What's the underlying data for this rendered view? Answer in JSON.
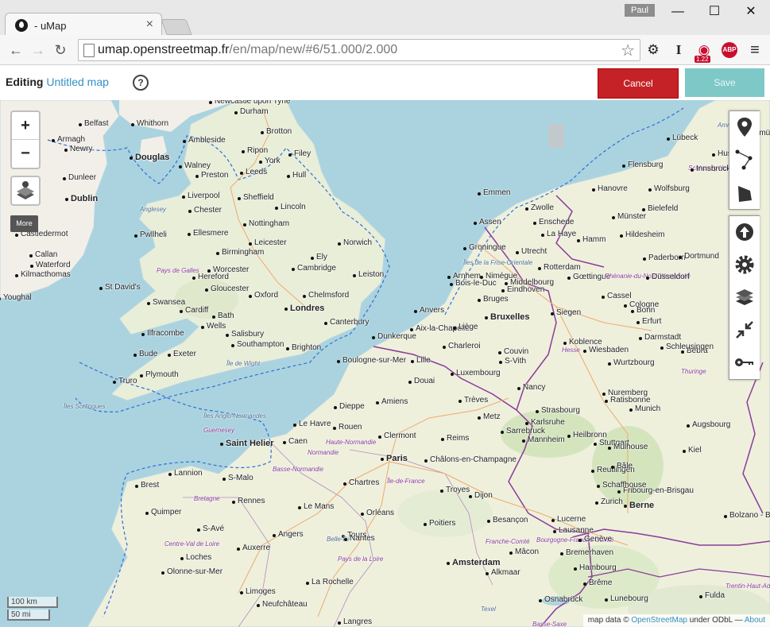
{
  "browser": {
    "tab_title": "- uMap",
    "tab_close": "×",
    "user": "Paul",
    "url_host": "umap.openstreetmap.fr",
    "url_path": "/en/map/new/#6/51.000/2.000",
    "minimize": "—",
    "maximize": "☐",
    "close": "✕",
    "ext_lock_version": "1.22",
    "ext_abp": "ABP"
  },
  "header": {
    "editing_label": "Editing",
    "map_name": "Untitled map",
    "help": "?",
    "cancel_label": "Cancel",
    "save_label": "Save"
  },
  "map_controls": {
    "zoom_in": "+",
    "zoom_out": "−",
    "more": "More"
  },
  "scale": {
    "km": "100 km",
    "mi": "50 mi"
  },
  "attribution": {
    "prefix": "map data ©",
    "osm": "OpenStreetMap",
    "license": "under ODbL —",
    "about": "About"
  },
  "places": [
    {
      "name": "Belfast",
      "type": "city"
    },
    {
      "name": "Armagh",
      "type": "city"
    },
    {
      "name": "Newry",
      "type": "city"
    },
    {
      "name": "Whithorn",
      "type": "city"
    },
    {
      "name": "Douglas",
      "type": "capital"
    },
    {
      "name": "Dunleer",
      "type": "city"
    },
    {
      "name": "Dublin",
      "type": "capital"
    },
    {
      "name": "Castledermot",
      "type": "city"
    },
    {
      "name": "Callan",
      "type": "city"
    },
    {
      "name": "Waterford",
      "type": "city"
    },
    {
      "name": "Kilmacthomas",
      "type": "city"
    },
    {
      "name": "Youghal",
      "type": "city"
    },
    {
      "name": "Newcastle upon Tyne",
      "type": "city"
    },
    {
      "name": "Durham",
      "type": "city"
    },
    {
      "name": "Brotton",
      "type": "city"
    },
    {
      "name": "Ambleside",
      "type": "city"
    },
    {
      "name": "Ripon",
      "type": "city"
    },
    {
      "name": "Filey",
      "type": "city"
    },
    {
      "name": "Walney",
      "type": "city"
    },
    {
      "name": "York",
      "type": "city"
    },
    {
      "name": "Preston",
      "type": "city"
    },
    {
      "name": "Leeds",
      "type": "city"
    },
    {
      "name": "Hull",
      "type": "city"
    },
    {
      "name": "Liverpool",
      "type": "city"
    },
    {
      "name": "Sheffield",
      "type": "city"
    },
    {
      "name": "Chester",
      "type": "city"
    },
    {
      "name": "Lincoln",
      "type": "city"
    },
    {
      "name": "Nottingham",
      "type": "city"
    },
    {
      "name": "Pwllheli",
      "type": "city"
    },
    {
      "name": "Ellesmere",
      "type": "city"
    },
    {
      "name": "Leicester",
      "type": "city"
    },
    {
      "name": "Norwich",
      "type": "city"
    },
    {
      "name": "Birmingham",
      "type": "city"
    },
    {
      "name": "Ely",
      "type": "city"
    },
    {
      "name": "Cambridge",
      "type": "city"
    },
    {
      "name": "Leiston",
      "type": "city"
    },
    {
      "name": "Worcester",
      "type": "city"
    },
    {
      "name": "Hereford",
      "type": "city"
    },
    {
      "name": "Gloucester",
      "type": "city"
    },
    {
      "name": "St David's",
      "type": "city"
    },
    {
      "name": "Oxford",
      "type": "city"
    },
    {
      "name": "Chelmsford",
      "type": "city"
    },
    {
      "name": "Londres",
      "type": "capital"
    },
    {
      "name": "Swansea",
      "type": "city"
    },
    {
      "name": "Cardiff",
      "type": "city"
    },
    {
      "name": "Bath",
      "type": "city"
    },
    {
      "name": "Wells",
      "type": "city"
    },
    {
      "name": "Canterbury",
      "type": "city"
    },
    {
      "name": "Ilfracombe",
      "type": "city"
    },
    {
      "name": "Salisbury",
      "type": "city"
    },
    {
      "name": "Southampton",
      "type": "city"
    },
    {
      "name": "Brighton",
      "type": "city"
    },
    {
      "name": "Bude",
      "type": "city"
    },
    {
      "name": "Exeter",
      "type": "city"
    },
    {
      "name": "Plymouth",
      "type": "city"
    },
    {
      "name": "Truro",
      "type": "city"
    },
    {
      "name": "Îles Sorlingues",
      "type": "sea"
    },
    {
      "name": "Anglesey",
      "type": "sea"
    },
    {
      "name": "Pays de Galles",
      "type": "region"
    },
    {
      "name": "Île de Wight",
      "type": "sea"
    },
    {
      "name": "Îles Anglo-Normandes",
      "type": "sea"
    },
    {
      "name": "Guernesey",
      "type": "region"
    },
    {
      "name": "Saint Helier",
      "type": "capital"
    },
    {
      "name": "Dunkerque",
      "type": "city"
    },
    {
      "name": "Boulogne-sur-Mer",
      "type": "city"
    },
    {
      "name": "Lille",
      "type": "city"
    },
    {
      "name": "Douai",
      "type": "city"
    },
    {
      "name": "Dieppe",
      "type": "city"
    },
    {
      "name": "Amiens",
      "type": "city"
    },
    {
      "name": "Le Havre",
      "type": "city"
    },
    {
      "name": "Rouen",
      "type": "city"
    },
    {
      "name": "Caen",
      "type": "city"
    },
    {
      "name": "Haute-Normandie",
      "type": "region"
    },
    {
      "name": "Normandie",
      "type": "region"
    },
    {
      "name": "Basse-Normandie",
      "type": "region"
    },
    {
      "name": "Clermont",
      "type": "city"
    },
    {
      "name": "Reims",
      "type": "city"
    },
    {
      "name": "Paris",
      "type": "capital"
    },
    {
      "name": "Châlons-en-Champagne",
      "type": "city"
    },
    {
      "name": "Île-de-France",
      "type": "region"
    },
    {
      "name": "Lannion",
      "type": "city"
    },
    {
      "name": "S-Malo",
      "type": "city"
    },
    {
      "name": "Brest",
      "type": "city"
    },
    {
      "name": "Bretagne",
      "type": "region"
    },
    {
      "name": "Rennes",
      "type": "city"
    },
    {
      "name": "Chartres",
      "type": "city"
    },
    {
      "name": "Troyes",
      "type": "city"
    },
    {
      "name": "Quimper",
      "type": "city"
    },
    {
      "name": "Le Mans",
      "type": "city"
    },
    {
      "name": "Orléans",
      "type": "city"
    },
    {
      "name": "S-Avé",
      "type": "city"
    },
    {
      "name": "Angers",
      "type": "city"
    },
    {
      "name": "Tours",
      "type": "city"
    },
    {
      "name": "Centre-Val de Loire",
      "type": "region"
    },
    {
      "name": "Belle-Île",
      "type": "sea"
    },
    {
      "name": "Nantes",
      "type": "city"
    },
    {
      "name": "Loches",
      "type": "city"
    },
    {
      "name": "Auxerre",
      "type": "city"
    },
    {
      "name": "Pays de la Loire",
      "type": "region"
    },
    {
      "name": "Poitiers",
      "type": "city"
    },
    {
      "name": "Olonne-sur-Mer",
      "type": "city"
    },
    {
      "name": "La Rochelle",
      "type": "city"
    },
    {
      "name": "Limoges",
      "type": "city"
    },
    {
      "name": "Neufchâteau",
      "type": "city"
    },
    {
      "name": "Langres",
      "type": "city"
    },
    {
      "name": "Dijon",
      "type": "city"
    },
    {
      "name": "Besançon",
      "type": "city"
    },
    {
      "name": "Franche-Comté",
      "type": "region"
    },
    {
      "name": "Bourgogne-Franche-Comté",
      "type": "region"
    },
    {
      "name": "Mâcon",
      "type": "city"
    },
    {
      "name": "Amsterdam",
      "type": "capital"
    },
    {
      "name": "Alkmaar",
      "type": "city"
    },
    {
      "name": "Texel",
      "type": "sea"
    },
    {
      "name": "Îles de la Frise-Orientale",
      "type": "sea"
    },
    {
      "name": "Groningue",
      "type": "city"
    },
    {
      "name": "Assen",
      "type": "city"
    },
    {
      "name": "Emmen",
      "type": "city"
    },
    {
      "name": "Zwolle",
      "type": "city"
    },
    {
      "name": "Enschede",
      "type": "city"
    },
    {
      "name": "La Haye",
      "type": "city"
    },
    {
      "name": "Utrecht",
      "type": "city"
    },
    {
      "name": "Rotterdam",
      "type": "city"
    },
    {
      "name": "Arnhem",
      "type": "city"
    },
    {
      "name": "Nimègue",
      "type": "city"
    },
    {
      "name": "Bois-le-Duc",
      "type": "city"
    },
    {
      "name": "Middelbourg",
      "type": "city"
    },
    {
      "name": "Eindhoven",
      "type": "city"
    },
    {
      "name": "Bruges",
      "type": "city"
    },
    {
      "name": "Anvers",
      "type": "city"
    },
    {
      "name": "Bruxelles",
      "type": "capital"
    },
    {
      "name": "Aix-la-Chapelle",
      "type": "city"
    },
    {
      "name": "Liège",
      "type": "city"
    },
    {
      "name": "Charleroi",
      "type": "city"
    },
    {
      "name": "Couvin",
      "type": "city"
    },
    {
      "name": "S-Vith",
      "type": "city"
    },
    {
      "name": "Luxembourg",
      "type": "city"
    },
    {
      "name": "Trèves",
      "type": "city"
    },
    {
      "name": "Metz",
      "type": "city"
    },
    {
      "name": "Nancy",
      "type": "city"
    },
    {
      "name": "Strasbourg",
      "type": "city"
    },
    {
      "name": "Sarrebruck",
      "type": "city"
    },
    {
      "name": "Karlsruhe",
      "type": "city"
    },
    {
      "name": "Mannheim",
      "type": "city"
    },
    {
      "name": "Heilbronn",
      "type": "city"
    },
    {
      "name": "Stuttgart",
      "type": "city"
    },
    {
      "name": "Reutlingen",
      "type": "city"
    },
    {
      "name": "Fribourg-en-Brisgau",
      "type": "city"
    },
    {
      "name": "Mulhouse",
      "type": "city"
    },
    {
      "name": "Bâle",
      "type": "city"
    },
    {
      "name": "Schaffhouse",
      "type": "city"
    },
    {
      "name": "Zurich",
      "type": "city"
    },
    {
      "name": "Berne",
      "type": "capital"
    },
    {
      "name": "Lucerne",
      "type": "city"
    },
    {
      "name": "Lausanne",
      "type": "city"
    },
    {
      "name": "Genève",
      "type": "city"
    },
    {
      "name": "Bremerhaven",
      "type": "city"
    },
    {
      "name": "Hambourg",
      "type": "city"
    },
    {
      "name": "Brême",
      "type": "city"
    },
    {
      "name": "Lunebourg",
      "type": "city"
    },
    {
      "name": "Basse-Saxe",
      "type": "region"
    },
    {
      "name": "Osnabrück",
      "type": "city"
    },
    {
      "name": "Hanovre",
      "type": "city"
    },
    {
      "name": "Wolfsburg",
      "type": "city"
    },
    {
      "name": "Münster",
      "type": "city"
    },
    {
      "name": "Bielefeld",
      "type": "city"
    },
    {
      "name": "Hildesheim",
      "type": "city"
    },
    {
      "name": "Hamm",
      "type": "city"
    },
    {
      "name": "Paderborn",
      "type": "city"
    },
    {
      "name": "Dortmund",
      "type": "city"
    },
    {
      "name": "Gœttingue",
      "type": "city"
    },
    {
      "name": "Rhénanie-du-Nord-Westphalie",
      "type": "region"
    },
    {
      "name": "Düsseldorf",
      "type": "city"
    },
    {
      "name": "Cassel",
      "type": "city"
    },
    {
      "name": "Cologne",
      "type": "city"
    },
    {
      "name": "Bonn",
      "type": "city"
    },
    {
      "name": "Siegen",
      "type": "city"
    },
    {
      "name": "Erfurt",
      "type": "city"
    },
    {
      "name": "Koblence",
      "type": "city"
    },
    {
      "name": "Hesse",
      "type": "region"
    },
    {
      "name": "Wiesbaden",
      "type": "city"
    },
    {
      "name": "Darmstadt",
      "type": "city"
    },
    {
      "name": "Wurtzbourg",
      "type": "city"
    },
    {
      "name": "Nuremberg",
      "type": "city"
    },
    {
      "name": "Ratisbonne",
      "type": "city"
    },
    {
      "name": "Munich",
      "type": "city"
    },
    {
      "name": "Augsbourg",
      "type": "city"
    },
    {
      "name": "Kiel",
      "type": "city"
    },
    {
      "name": "Lübeck",
      "type": "city"
    },
    {
      "name": "Schleswig-Holstein",
      "type": "region"
    },
    {
      "name": "Flensburg",
      "type": "city"
    },
    {
      "name": "Husum",
      "type": "city"
    },
    {
      "name": "Amrum",
      "type": "sea"
    },
    {
      "name": "Neumünster",
      "type": "city"
    },
    {
      "name": "Innsbruck",
      "type": "city"
    },
    {
      "name": "Bolzano - Bozen",
      "type": "city"
    },
    {
      "name": "Trentin-Haut-Adige",
      "type": "region"
    },
    {
      "name": "Fulda",
      "type": "city"
    },
    {
      "name": "Bebra",
      "type": "city"
    },
    {
      "name": "Schleusingen",
      "type": "city"
    },
    {
      "name": "Thuringe",
      "type": "region"
    }
  ]
}
